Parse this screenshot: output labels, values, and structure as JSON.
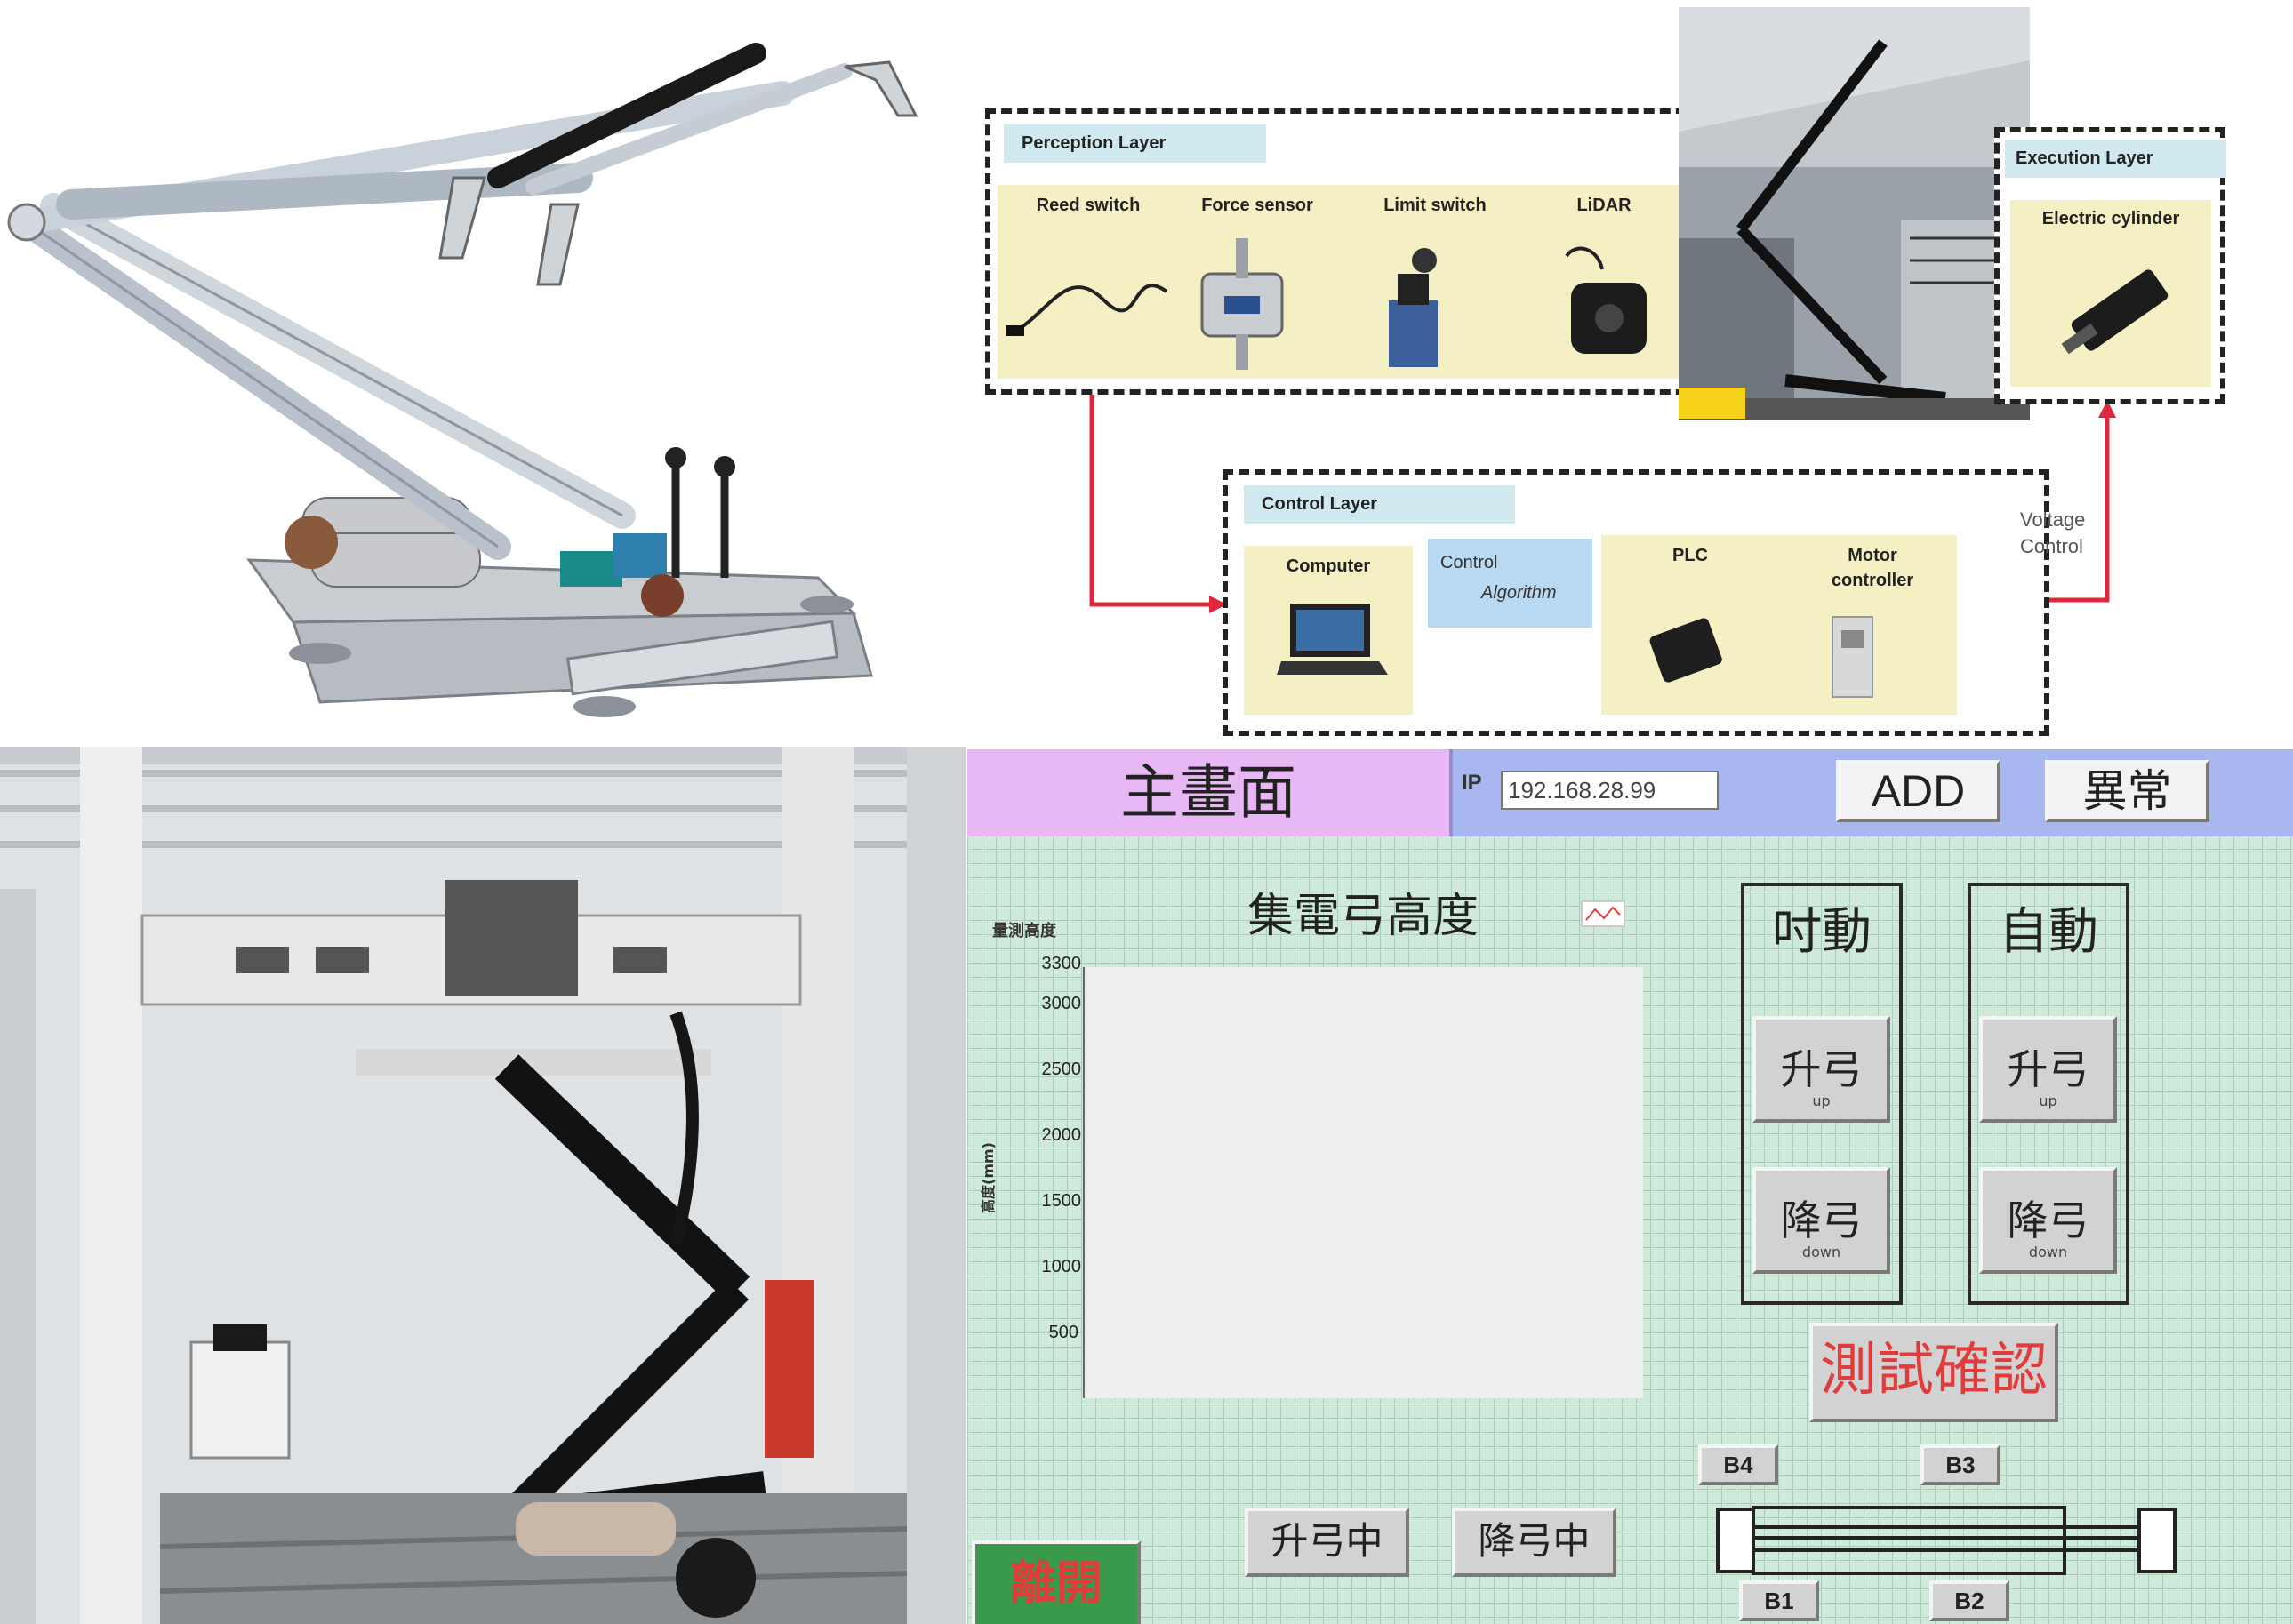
{
  "diagram": {
    "perception": {
      "title": "Perception Layer",
      "items": [
        "Reed switch",
        "Force sensor",
        "Limit switch",
        "LiDAR"
      ]
    },
    "execution": {
      "title": "Execution Layer",
      "items": [
        "Electric cylinder"
      ]
    },
    "control": {
      "title": "Control Layer",
      "computer": "Computer",
      "algorithm_line1": "Control",
      "algorithm_line2": "Algorithm",
      "plc": "PLC",
      "motor_line1": "Motor",
      "motor_line2": "controller"
    },
    "voltage_line1": "Voltage",
    "voltage_line2": "Control"
  },
  "hmi": {
    "title": "主畫面",
    "ip_label": "IP",
    "ip_value": "192.168.28.99",
    "add_button": "ADD",
    "alarm_button": "異常",
    "chart_title": "集電弓高度",
    "chart_ylabel_top": "量測高度",
    "chart_ylabel_side": "高度(mm)",
    "chart_yticks": [
      "3300",
      "3000",
      "2500",
      "2000",
      "1500",
      "1000",
      "500"
    ],
    "jog_title": "吋動",
    "auto_title": "自動",
    "raise_label": "升弓",
    "raise_sub": "up",
    "lower_label": "降弓",
    "lower_sub": "down",
    "test_button": "測試確認",
    "raising_button": "升弓中",
    "lowering_button": "降弓中",
    "exit_button": "離開",
    "b_labels": [
      "B4",
      "B3",
      "B1",
      "B2"
    ],
    "colors": {
      "hmi_bg": "#cfeadb",
      "title_bar": "#e8b8f4",
      "header_bar": "#a9b7f0",
      "alarm_red": "#e23b3b"
    }
  }
}
